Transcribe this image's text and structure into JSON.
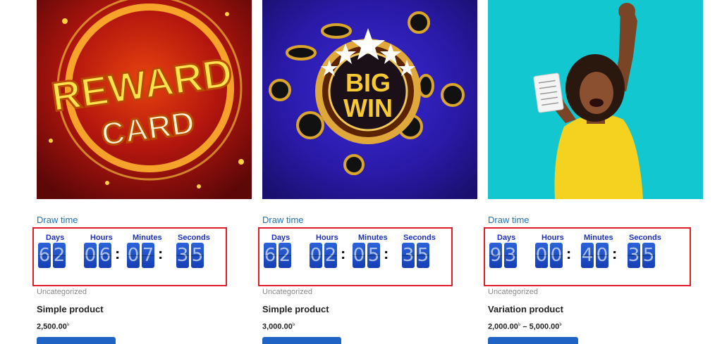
{
  "products": [
    {
      "image_alt": "Reward Card",
      "draw_label": "Draw time",
      "countdown": {
        "labels": [
          "Days",
          "Hours",
          "Minutes",
          "Seconds"
        ],
        "days": [
          "6",
          "2"
        ],
        "hours": [
          "0",
          "6"
        ],
        "minutes": [
          "0",
          "7"
        ],
        "seconds": [
          "3",
          "5"
        ]
      },
      "category": "Uncategorized",
      "name": "Simple product",
      "price": "2,500.00",
      "currency": "৳"
    },
    {
      "image_alt": "Big Win",
      "draw_label": "Draw time",
      "countdown": {
        "labels": [
          "Days",
          "Hours",
          "Minutes",
          "Seconds"
        ],
        "days": [
          "6",
          "2"
        ],
        "hours": [
          "0",
          "2"
        ],
        "minutes": [
          "0",
          "5"
        ],
        "seconds": [
          "3",
          "5"
        ]
      },
      "category": "Uncategorized",
      "name": "Simple product",
      "price": "3,000.00",
      "currency": "৳"
    },
    {
      "image_alt": "Lottery winner",
      "draw_label": "Draw time",
      "countdown": {
        "labels": [
          "Days",
          "Hours",
          "Minutes",
          "Seconds"
        ],
        "days": [
          "9",
          "3"
        ],
        "hours": [
          "0",
          "0"
        ],
        "minutes": [
          "4",
          "0"
        ],
        "seconds": [
          "3",
          "5"
        ]
      },
      "category": "Uncategorized",
      "name": "Variation product",
      "price_min": "2,000.00",
      "price_sep": "–",
      "price_max": "5,000.00",
      "currency": "৳"
    }
  ],
  "image_text": {
    "reward_1": "REWARD",
    "reward_2": "CARD",
    "big": "BIG",
    "win": "WIN"
  },
  "colors": {
    "link": "#2271b1",
    "highlight_border": "#e11d2a",
    "digit_bg": "#1f4fc8",
    "button": "#1f64c4"
  }
}
